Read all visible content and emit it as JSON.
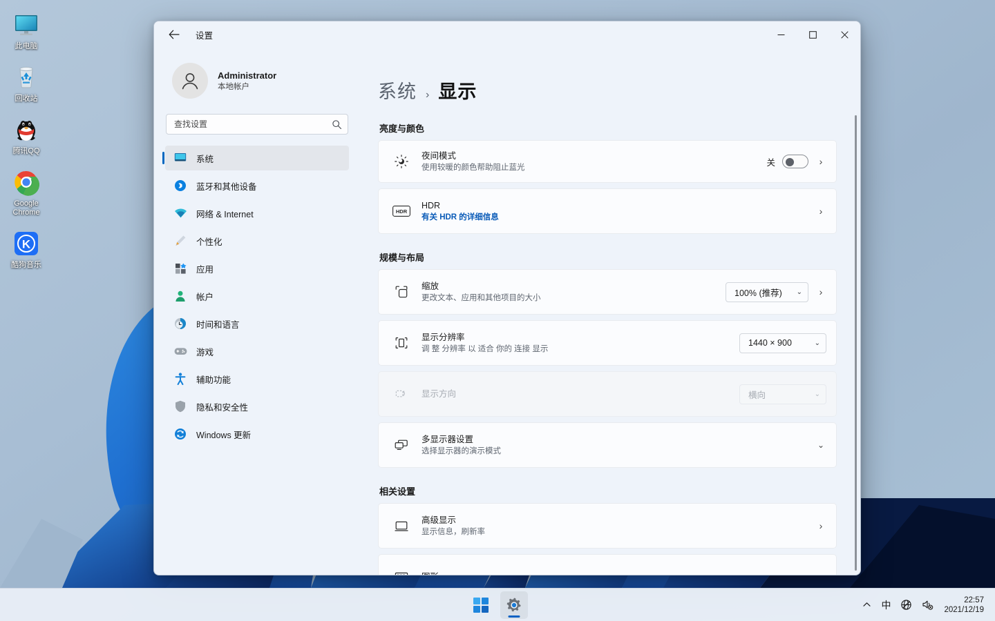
{
  "desktop": {
    "icons": [
      {
        "label": "此电脑",
        "icon": "this-pc-icon"
      },
      {
        "label": "回收站",
        "icon": "recycle-bin-icon"
      },
      {
        "label": "腾讯QQ",
        "icon": "tencent-qq-icon"
      },
      {
        "label": "Google Chrome",
        "icon": "google-chrome-icon"
      },
      {
        "label": "酷狗音乐",
        "icon": "kugou-music-icon"
      }
    ]
  },
  "window": {
    "title": "设置",
    "back_label": "←",
    "controls": {
      "minimize": "—",
      "maximize": "□",
      "close": "✕"
    }
  },
  "sidebar": {
    "account": {
      "name": "Administrator",
      "subtitle": "本地帐户",
      "avatar": "user-avatar-icon"
    },
    "search": {
      "placeholder": "查找设置",
      "value": "",
      "icon": "search-icon"
    },
    "items": [
      {
        "label": "系统",
        "icon": "system-icon",
        "active": true
      },
      {
        "label": "蓝牙和其他设备",
        "icon": "bluetooth-icon",
        "active": false
      },
      {
        "label": "网络 & Internet",
        "icon": "network-icon",
        "active": false
      },
      {
        "label": "个性化",
        "icon": "personalization-icon",
        "active": false
      },
      {
        "label": "应用",
        "icon": "apps-icon",
        "active": false
      },
      {
        "label": "帐户",
        "icon": "accounts-icon",
        "active": false
      },
      {
        "label": "时间和语言",
        "icon": "time-language-icon",
        "active": false
      },
      {
        "label": "游戏",
        "icon": "gaming-icon",
        "active": false
      },
      {
        "label": "辅助功能",
        "icon": "accessibility-icon",
        "active": false
      },
      {
        "label": "隐私和安全性",
        "icon": "privacy-security-icon",
        "active": false
      },
      {
        "label": "Windows 更新",
        "icon": "windows-update-icon",
        "active": false
      }
    ]
  },
  "content": {
    "breadcrumb": {
      "parent": "系统",
      "separator": "›",
      "current": "显示"
    },
    "sections": {
      "brightness": {
        "title": "亮度与颜色",
        "night_light": {
          "title": "夜间模式",
          "subtitle": "使用较暖的颜色帮助阻止蓝光",
          "toggle_label": "关",
          "toggle_on": false,
          "icon": "brightness-sun-icon"
        },
        "hdr": {
          "title": "HDR",
          "link": "有关 HDR 的详细信息",
          "icon": "hdr-badge-icon"
        }
      },
      "scale_layout": {
        "title": "规模与布局",
        "scale": {
          "title": "缩放",
          "subtitle": "更改文本、应用和其他项目的大小",
          "value": "100% (推荐)",
          "icon": "scale-icon"
        },
        "resolution": {
          "title": "显示分辨率",
          "subtitle": "调 整 分辨率 以 适合 你的 连接 显示",
          "value": "1440 × 900",
          "icon": "resolution-icon"
        },
        "orientation": {
          "title": "显示方向",
          "value": "横向",
          "disabled": true,
          "icon": "orientation-icon"
        },
        "multi_display": {
          "title": "多显示器设置",
          "subtitle": "选择显示器的演示模式",
          "icon": "multi-display-icon"
        }
      },
      "related": {
        "title": "相关设置",
        "advanced": {
          "title": "高级显示",
          "subtitle": "显示信息，刷新率",
          "icon": "advanced-display-icon"
        },
        "graphics": {
          "title": "图形",
          "icon": "graphics-icon"
        }
      }
    }
  },
  "taskbar": {
    "start": {
      "label": "开始",
      "icon": "windows-start-icon"
    },
    "settings": {
      "label": "设置",
      "icon": "settings-gear-icon",
      "active": true
    },
    "tray": {
      "overflow": "⌃",
      "ime": "中",
      "network_icon": "network-disconnected-icon",
      "volume_icon": "volume-muted-icon"
    },
    "clock": {
      "time": "22:57",
      "date": "2021/12/19"
    }
  },
  "colors": {
    "accent": "#0067c0",
    "link": "#0a5bb8",
    "window_bg": "#eef3fa",
    "card_bg": "#fbfcfe",
    "desktop_bg": "#a8bed4"
  }
}
